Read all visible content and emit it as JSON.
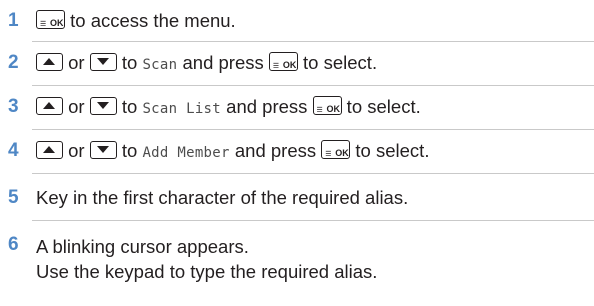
{
  "steps": [
    {
      "number": "1",
      "text_after_key": " to access the menu."
    },
    {
      "number": "2",
      "or_text": " or ",
      "to_text": " to ",
      "target": "Scan",
      "press_text": " and press ",
      "end_text": " to select."
    },
    {
      "number": "3",
      "or_text": " or ",
      "to_text": " to ",
      "target": "Scan List",
      "press_text": " and press ",
      "end_text": " to select."
    },
    {
      "number": "4",
      "or_text": " or ",
      "to_text": " to ",
      "target": "Add Member",
      "press_text": " and press ",
      "end_text": " to select."
    },
    {
      "number": "5",
      "text": "Key in the first character of the required alias."
    },
    {
      "number": "6",
      "line1": "A blinking cursor appears.",
      "line2": "Use the keypad to type the required alias."
    }
  ],
  "icons": {
    "menu_ok_key": "menu-ok-key-icon",
    "up_key": "up-arrow-key-icon",
    "down_key": "down-arrow-key-icon"
  },
  "menu_key_label": "OK",
  "colors": {
    "step_number": "#4f87c5",
    "separator": "#c9c9c9",
    "menu_name_text": "#4d4d4d",
    "body_text": "#231f20"
  }
}
